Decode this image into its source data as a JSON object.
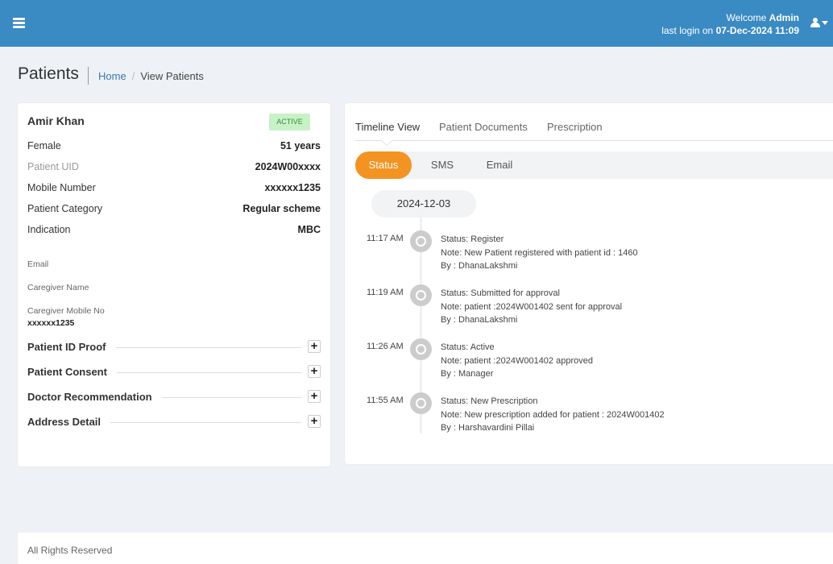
{
  "header": {
    "welcome_prefix": "Welcome",
    "user": "Admin",
    "last_login_label": "last login on",
    "last_login_value": "07-Dec-2024 11:09",
    "colors": {
      "topbar": "#3a8ac3"
    }
  },
  "page": {
    "title": "Patients",
    "breadcrumb": [
      "Home",
      "View Patients"
    ]
  },
  "patient": {
    "name": "Amir Khan",
    "status": "ACTIVE",
    "gender": "Female",
    "age": "51 years",
    "details": [
      {
        "label": "Patient UID",
        "value": "2024W00xxxx"
      },
      {
        "label": "Mobile Number",
        "value": "xxxxxx1235"
      },
      {
        "label": "Patient Category",
        "value": "Regular scheme"
      },
      {
        "label": "Indication",
        "value": "MBC"
      }
    ],
    "email_label": "Email",
    "caregiver_name_label": "Caregiver Name",
    "caregiver_mobile_label": "Caregiver Mobile No",
    "caregiver_mobile_value": "xxxxxx1235",
    "sections": [
      "Patient ID Proof",
      "Patient Consent",
      "Doctor Recommendation",
      "Address Detail"
    ],
    "expand_symbol": "+"
  },
  "tabs": [
    "Timeline View",
    "Patient Documents",
    "Prescription"
  ],
  "subtabs": [
    "Status",
    "SMS",
    "Email"
  ],
  "timeline": {
    "date": "2024-12-03",
    "accent_color": "#f39321",
    "entries": [
      {
        "time": "11:17 AM",
        "lines": [
          "Status: Register",
          "Note: New Patient registered with patient id : 1460",
          "By : DhanaLakshmi"
        ]
      },
      {
        "time": "11:19 AM",
        "lines": [
          "Status: Submitted for approval",
          "Note: patient :2024W001402 sent for approval",
          "By : DhanaLakshmi"
        ]
      },
      {
        "time": "11:26 AM",
        "lines": [
          "Status: Active",
          "Note: patient :2024W001402 approved",
          "By : Manager"
        ]
      },
      {
        "time": "11:55 AM",
        "lines": [
          "Status: New Prescription",
          "Note: New prescription added for patient : 2024W001402",
          "By : Harshavardini Pillai"
        ]
      }
    ]
  },
  "footer": {
    "text": "All Rights Reserved"
  }
}
